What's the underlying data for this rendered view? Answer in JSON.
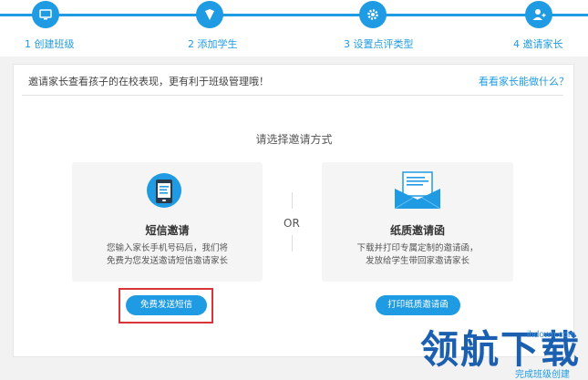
{
  "steps": [
    {
      "label": "1 创建班级",
      "icon": "monitor-icon"
    },
    {
      "label": "2 添加学生",
      "icon": "badge-icon"
    },
    {
      "label": "3 设置点评类型",
      "icon": "gear-icon"
    },
    {
      "label": "4 邀请家长",
      "icon": "add-user-icon"
    }
  ],
  "notice": {
    "text": "邀请家长查看孩子的在校表现，更有利于班级管理哦！",
    "link": "看看家长能做什么？"
  },
  "choose_title": "请选择邀请方式",
  "sms_option": {
    "title": "短信邀请",
    "desc_line1": "您输入家长手机号码后，我们将",
    "desc_line2": "免费为您发送邀请短信邀请家长",
    "button": "免费发送短信",
    "icon": "phone-icon"
  },
  "or_label": "OR",
  "paper_option": {
    "title": "纸质邀请函",
    "desc_line1": "下载并打印专属定制的邀请函，",
    "desc_line2": "发放给学生带回家邀请家长",
    "button": "打印纸质邀请函",
    "icon": "envelope-icon"
  },
  "finish_link": "完成班级创建",
  "watermark": {
    "text": "领航下载",
    "url": "ihdown.com"
  },
  "colors": {
    "accent": "#1f9be3",
    "highlight": "#d9343a",
    "watermark": "#1a5fb0"
  }
}
